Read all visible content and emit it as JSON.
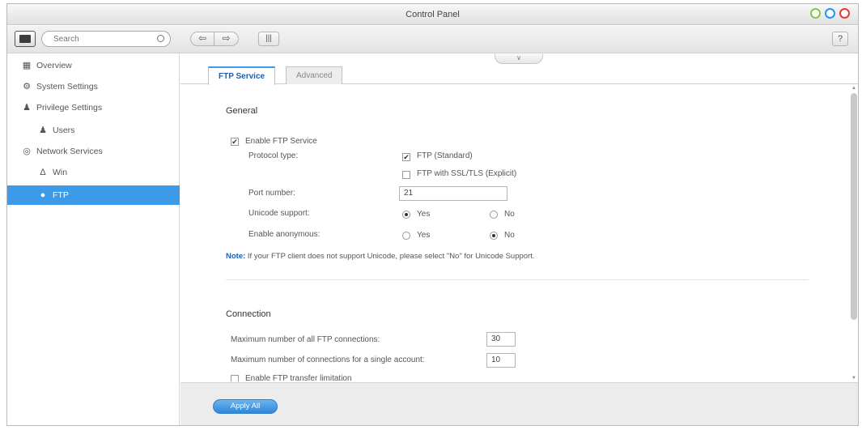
{
  "window": {
    "title": "Control Panel"
  },
  "toolbar": {
    "search_placeholder": "Search",
    "back_label": "⇦",
    "forward_label": "⇨",
    "grid_label": "|||",
    "help_label": "?"
  },
  "sidebar": {
    "items": [
      {
        "label": "Overview",
        "icon": "overview-icon",
        "glyph": "▦"
      },
      {
        "label": "System Settings",
        "icon": "gear-icon",
        "glyph": "⚙"
      },
      {
        "label": "Privilege Settings",
        "icon": "user-icon",
        "glyph": "♟"
      },
      {
        "label": "Users",
        "icon": "user-icon",
        "glyph": "♟"
      },
      {
        "label": "Network Services",
        "icon": "globe-icon",
        "glyph": "◎"
      },
      {
        "label": "Win",
        "icon": "network-icon",
        "glyph": "∆"
      },
      {
        "label": "FTP",
        "icon": "ftp-icon",
        "glyph": "●"
      }
    ],
    "selected": "FTP"
  },
  "tabs": {
    "ftp": "FTP Service",
    "advanced": "Advanced",
    "collapse": "∨"
  },
  "general": {
    "title": "General",
    "enable_ftp": "Enable FTP Service",
    "protocol_label": "Protocol type:",
    "protocol_standard": "FTP (Standard)",
    "protocol_ssl": "FTP with SSL/TLS (Explicit)",
    "port_label": "Port number:",
    "port_value": "21",
    "unicode_label": "Unicode support:",
    "anonymous_label": "Enable anonymous:",
    "yes": "Yes",
    "no": "No",
    "note_prefix": "Note:",
    "note_text": "If your FTP client does not support Unicode, please select \"No\" for Unicode Support."
  },
  "connection": {
    "title": "Connection",
    "max_all_label": "Maximum number of all FTP connections:",
    "max_all_value": "30",
    "max_single_label": "Maximum number of connections for a single account:",
    "max_single_value": "10",
    "transfer_limit": "Enable FTP transfer limitation"
  },
  "footer": {
    "apply_label": "Apply All"
  }
}
